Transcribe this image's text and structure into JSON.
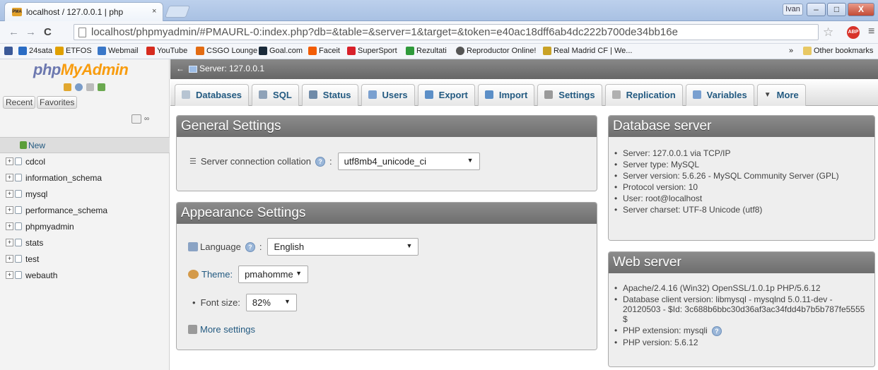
{
  "browser": {
    "tab_title": "localhost / 127.0.0.1 | php",
    "tab_close": "×",
    "user_badge": "Ivan",
    "minimize": "–",
    "maximize": "□",
    "close": "X",
    "back": "←",
    "forward": "→",
    "reload": "C",
    "url": "localhost/phpmyadmin/#PMAURL-0:index.php?db=&table=&server=1&target=&token=e40ac18dff6ab4dc222b700de34bb16e",
    "abp": "ABP",
    "bookmarks": [
      {
        "label": "24sata",
        "color": "#2a6cc4"
      },
      {
        "label": "ETFOS",
        "color": "#e0a000"
      },
      {
        "label": "Webmail",
        "color": "#3a77c8"
      },
      {
        "label": "YouTube",
        "color": "#d62b1f"
      },
      {
        "label": "CSGO Lounge",
        "color": "#e36b12"
      },
      {
        "label": "Goal.com",
        "color": "#1a2a3a"
      },
      {
        "label": "Faceit",
        "color": "#f25c05"
      },
      {
        "label": "SuperSport",
        "color": "#d8202a"
      },
      {
        "label": "Rezultati",
        "color": "#2f9a3b"
      },
      {
        "label": "Reproductor Online!",
        "color": "#555555"
      },
      {
        "label": "Real Madrid CF | We...",
        "color": "#c9a227"
      }
    ],
    "bookmark_overflow": "»",
    "other_bookmarks": "Other bookmarks"
  },
  "sidebar": {
    "logo_a": "php",
    "logo_b": "MyAdmin",
    "recent": "Recent",
    "favorites": "Favorites",
    "link_icon": "∞",
    "new_label": "New",
    "databases": [
      "cdcol",
      "information_schema",
      "mysql",
      "performance_schema",
      "phpmyadmin",
      "stats",
      "test",
      "webauth"
    ]
  },
  "topbar": {
    "back_arrow": "←",
    "server_label": "Server: 127.0.0.1"
  },
  "tabs": [
    {
      "label": "Databases",
      "icon": "database-icon",
      "color": "#b7c4d2"
    },
    {
      "label": "SQL",
      "icon": "sql-icon",
      "color": "#8fa2b8"
    },
    {
      "label": "Status",
      "icon": "status-icon",
      "color": "#6f8aa8"
    },
    {
      "label": "Users",
      "icon": "users-icon",
      "color": "#7aa0d0"
    },
    {
      "label": "Export",
      "icon": "export-icon",
      "color": "#5c8fc7"
    },
    {
      "label": "Import",
      "icon": "import-icon",
      "color": "#5c8fc7"
    },
    {
      "label": "Settings",
      "icon": "wrench-icon",
      "color": "#9a9a9a"
    },
    {
      "label": "Replication",
      "icon": "replication-icon",
      "color": "#b0b0b0"
    },
    {
      "label": "Variables",
      "icon": "variables-icon",
      "color": "#7aa0d0"
    },
    {
      "label": "More",
      "icon": "caret-down-icon",
      "color": "#444444"
    }
  ],
  "general": {
    "title": "General Settings",
    "collation_label": "Server connection collation",
    "collation_value": "utf8mb4_unicode_ci"
  },
  "appearance": {
    "title": "Appearance Settings",
    "language_label": "Language",
    "language_value": "English",
    "theme_label": "Theme:",
    "theme_value": "pmahomme",
    "fontsize_label": "Font size:",
    "fontsize_value": "82%",
    "more_settings": "More settings"
  },
  "dbserver": {
    "title": "Database server",
    "items": [
      "Server: 127.0.0.1 via TCP/IP",
      "Server type: MySQL",
      "Server version: 5.6.26 - MySQL Community Server (GPL)",
      "Protocol version: 10",
      "User: root@localhost",
      "Server charset: UTF-8 Unicode (utf8)"
    ]
  },
  "webserver": {
    "title": "Web server",
    "items": [
      "Apache/2.4.16 (Win32) OpenSSL/1.0.1p PHP/5.6.12",
      "Database client version: libmysql - mysqlnd 5.0.11-dev - 20120503 - $Id: 3c688b6bbc30d36af3ac34fdd4b7b5b787fe5555 $",
      "PHP extension: mysqli",
      "PHP version: 5.6.12"
    ]
  },
  "colors": {
    "pma_blue": "#235a81",
    "panel_header": "#777777"
  }
}
